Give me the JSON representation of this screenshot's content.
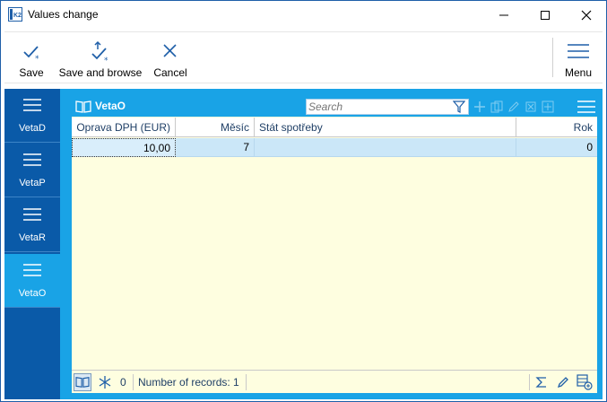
{
  "window": {
    "title": "Values change",
    "app_icon": "k2-app-icon",
    "controls": [
      "minimize-icon",
      "maximize-icon",
      "close-icon"
    ]
  },
  "toolbar": {
    "save_label": "Save",
    "save_browse_label": "Save and browse",
    "cancel_label": "Cancel",
    "menu_label": "Menu",
    "accent": "#1f5fa8"
  },
  "sidebar": {
    "items": [
      {
        "label": "VetaD",
        "icon": "list-icon",
        "active": false
      },
      {
        "label": "VetaP",
        "icon": "list-icon",
        "active": false
      },
      {
        "label": "VetaR",
        "icon": "list-icon",
        "active": false
      },
      {
        "label": "VetaO",
        "icon": "list-icon",
        "active": true
      }
    ],
    "color": "#0a5aa8",
    "active_color": "#19a3e6"
  },
  "panel": {
    "title": "VetaO",
    "title_icon": "book-icon",
    "search_placeholder": "Search",
    "header_color": "#19a3e6",
    "background": "#fefee0"
  },
  "grid": {
    "columns": [
      "Oprava DPH (EUR)",
      "Měsíc",
      "Stát spotřeby",
      "Rok"
    ],
    "rows": [
      {
        "oprava": "10,00",
        "mesic": "7",
        "stat": "",
        "rok": "0"
      }
    ],
    "selected_row_color": "#cbe7f8"
  },
  "statusbar": {
    "filter_count": "0",
    "records_text": "Number of records: 1"
  }
}
